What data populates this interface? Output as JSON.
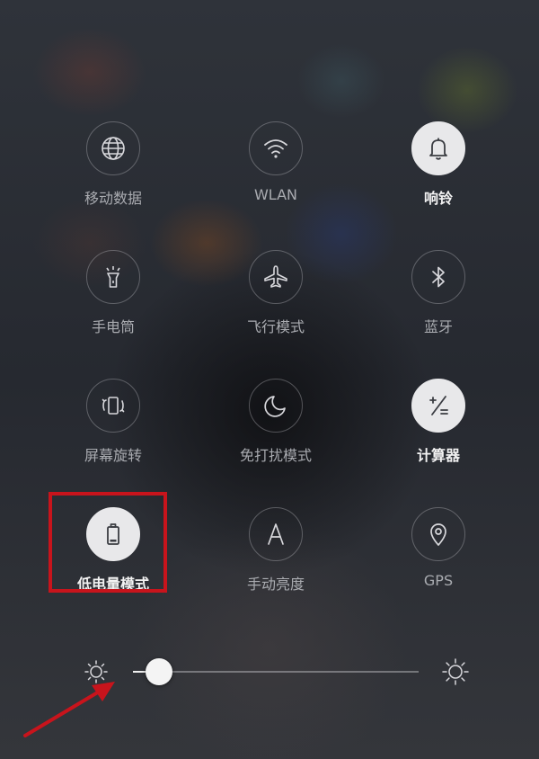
{
  "tiles": [
    {
      "label": "移动数据",
      "icon": "globe-icon",
      "active": false
    },
    {
      "label": "WLAN",
      "icon": "wifi-icon",
      "active": false
    },
    {
      "label": "响铃",
      "icon": "bell-icon",
      "active": true
    },
    {
      "label": "手电筒",
      "icon": "flashlight-icon",
      "active": false
    },
    {
      "label": "飞行模式",
      "icon": "airplane-icon",
      "active": false
    },
    {
      "label": "蓝牙",
      "icon": "bluetooth-icon",
      "active": false
    },
    {
      "label": "屏幕旋转",
      "icon": "rotate-screen-icon",
      "active": false
    },
    {
      "label": "免打扰模式",
      "icon": "moon-icon",
      "active": false
    },
    {
      "label": "计算器",
      "icon": "calculator-icon",
      "active": true
    },
    {
      "label": "低电量模式",
      "icon": "battery-icon",
      "active": true
    },
    {
      "label": "手动亮度",
      "icon": "letter-a-icon",
      "active": false
    },
    {
      "label": "GPS",
      "icon": "location-pin-icon",
      "active": false
    }
  ],
  "brightness": {
    "level_percent": 9,
    "low_icon": "sun-small-icon",
    "high_icon": "sun-large-icon"
  },
  "annotation": {
    "highlight_color": "#c8141c",
    "arrow_color": "#c8141c"
  },
  "colors": {
    "active_circle": "#e8e8ea",
    "inactive_label": "#a9abb0",
    "active_label": "#f2f2f2"
  }
}
